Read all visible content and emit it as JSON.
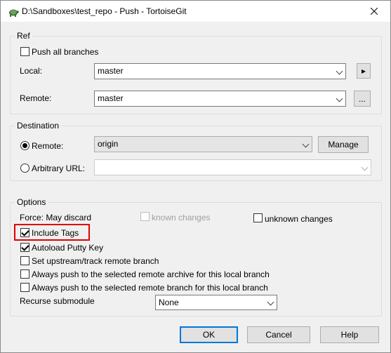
{
  "window": {
    "title": "D:\\Sandboxes\\test_repo - Push - TortoiseGit"
  },
  "ref": {
    "group_label": "Ref",
    "push_all_branches": "Push all branches",
    "push_all_branches_checked": false,
    "local_label": "Local:",
    "local_value": "master",
    "remote_label": "Remote:",
    "remote_value": "master",
    "local_arrow": "▸",
    "remote_more": "..."
  },
  "destination": {
    "group_label": "Destination",
    "remote_label": "Remote:",
    "remote_selected": true,
    "remote_value": "origin",
    "manage_label": "Manage",
    "arbitrary_label": "Arbitrary URL:",
    "arbitrary_selected": false,
    "arbitrary_value": ""
  },
  "options": {
    "group_label": "Options",
    "force_label": "Force: May discard",
    "known_changes": "known changes",
    "known_changes_checked": false,
    "unknown_changes": "unknown changes",
    "unknown_changes_checked": false,
    "include_tags": "Include Tags",
    "include_tags_checked": true,
    "autoload_putty": "Autoload Putty Key",
    "autoload_putty_checked": true,
    "set_upstream": "Set upstream/track remote branch",
    "set_upstream_checked": false,
    "always_push_archive": "Always push to the selected remote archive for this local branch",
    "always_push_archive_checked": false,
    "always_push_branch": "Always push to the selected remote branch for this local branch",
    "always_push_branch_checked": false,
    "recurse_label": "Recurse submodule",
    "recurse_value": "None"
  },
  "footer": {
    "ok": "OK",
    "cancel": "Cancel",
    "help": "Help"
  },
  "colors": {
    "highlight": "#e00000",
    "accent": "#0078d7"
  }
}
